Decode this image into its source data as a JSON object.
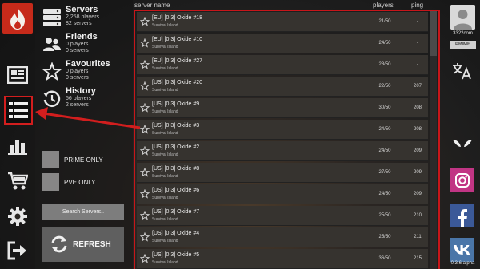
{
  "nav": {
    "items": [
      {
        "name": "news"
      },
      {
        "name": "servers",
        "active": true
      },
      {
        "name": "stats"
      },
      {
        "name": "shop"
      },
      {
        "name": "settings"
      },
      {
        "name": "exit"
      }
    ]
  },
  "categories": [
    {
      "title": "Servers",
      "line1": "2,258 players",
      "line2": "82 servers",
      "icon": "server-stack-icon"
    },
    {
      "title": "Friends",
      "line1": "0 players",
      "line2": "0 servers",
      "icon": "friends-icon"
    },
    {
      "title": "Favourites",
      "line1": "0 players",
      "line2": "0 servers",
      "icon": "star-icon"
    },
    {
      "title": "History",
      "line1": "56 players",
      "line2": "2 servers",
      "icon": "history-icon"
    }
  ],
  "filters": {
    "prime_only": "PRIME ONLY",
    "pve_only": "PVE ONLY"
  },
  "buttons": {
    "search": "Search Servers..",
    "refresh": "REFRESH"
  },
  "list": {
    "headers": {
      "name": "server name",
      "players": "players",
      "ping": "ping"
    },
    "rows": [
      {
        "name": "[EU] [0.3] Oxide #18",
        "map": "Survival Island",
        "players": "21/50",
        "ping": "-"
      },
      {
        "name": "[EU] [0.3] Oxide #10",
        "map": "Survival Island",
        "players": "24/50",
        "ping": "-"
      },
      {
        "name": "[EU] [0.3] Oxide #27",
        "map": "Survival Island",
        "players": "28/50",
        "ping": "-"
      },
      {
        "name": "[US] [0.3] Oxide #20",
        "map": "Survival Island",
        "players": "22/50",
        "ping": "207"
      },
      {
        "name": "[US] [0.3] Oxide #9",
        "map": "Survival Island",
        "players": "30/50",
        "ping": "208"
      },
      {
        "name": "[US] [0.3] Oxide #3",
        "map": "Survival Island",
        "players": "24/50",
        "ping": "208"
      },
      {
        "name": "[US] [0.3] Oxide #2",
        "map": "Survival Island",
        "players": "24/50",
        "ping": "209"
      },
      {
        "name": "[US] [0.3] Oxide #8",
        "map": "Survival Island",
        "players": "27/50",
        "ping": "209"
      },
      {
        "name": "[US] [0.3] Oxide #6",
        "map": "Survival Island",
        "players": "24/50",
        "ping": "209"
      },
      {
        "name": "[US] [0.3] Oxide #7",
        "map": "Survival Island",
        "players": "25/50",
        "ping": "210"
      },
      {
        "name": "[US] [0.3] Oxide #4",
        "map": "Survival Island",
        "players": "25/50",
        "ping": "211"
      },
      {
        "name": "[US] [0.3] Oxide #5",
        "map": "Survival Island",
        "players": "36/50",
        "ping": "215"
      }
    ]
  },
  "profile": {
    "username": "3322com",
    "badge": "PRIME"
  },
  "social": [
    "alien-icon",
    "instagram-icon",
    "facebook-icon",
    "vk-icon"
  ],
  "version": "0.3.6 alpha",
  "colors": {
    "accent_red": "#c8161a",
    "instagram": "#c13584",
    "facebook": "#3b5998",
    "vk": "#4a76a8"
  }
}
